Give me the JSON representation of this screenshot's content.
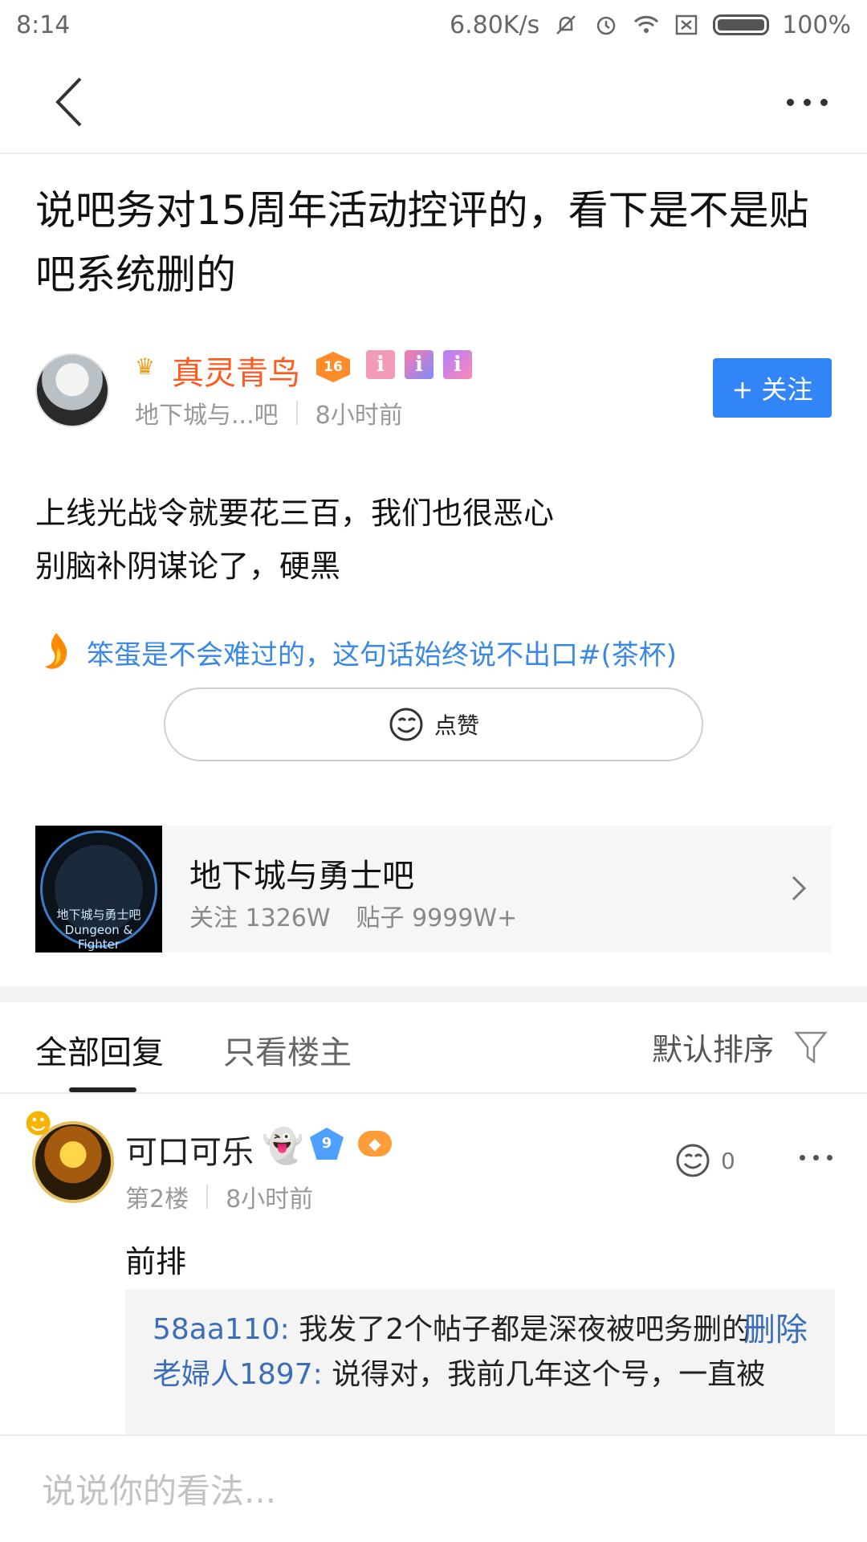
{
  "status_bar": {
    "time": "8:14",
    "network_speed": "6.80K/s",
    "battery": "100%",
    "icons": [
      "bell-mute-icon",
      "alarm-icon",
      "wifi-icon",
      "sim-x-icon",
      "battery-icon"
    ]
  },
  "post": {
    "title": "说吧务对15周年活动控评的，看下是不是贴吧系统删的",
    "author": {
      "name": "真灵青鸟",
      "level": "16",
      "info_badge": "i",
      "forum": "地下城与...吧",
      "time": "8小时前"
    },
    "follow_label": "+ 关注",
    "body_lines": [
      "上线光战令就要花三百，我们也很恶心",
      "别脑补阴谋论了，硬黑"
    ],
    "signature": "笨蛋是不会难过的，这句话始终说不出口#(茶杯)",
    "like_label": "点赞"
  },
  "forum_card": {
    "name": "地下城与勇士吧",
    "followers": "关注 1326W",
    "posts": "贴子 9999W+",
    "logo_text": "地下城与勇士吧 Dungeon & Fighter"
  },
  "tabs": {
    "all_replies": "全部回复",
    "op_only": "只看楼主",
    "sort": "默认排序"
  },
  "replies": [
    {
      "user": "可口可乐",
      "level": "9",
      "floor": "第2楼",
      "time": "8小时前",
      "likes": "0",
      "text": "前排",
      "sub_replies": [
        {
          "user": "58aa110:",
          "text": "我发了2个帖子都是深夜被吧务删的"
        },
        {
          "user": "老婦人1897:",
          "text": "说得对，我前几年这个号，一直被"
        }
      ],
      "delete_label": "删除"
    }
  ],
  "comment_bar": {
    "placeholder": "说说你的看法..."
  },
  "colors": {
    "accent_blue": "#3285f7",
    "author_orange": "#ff5a1f",
    "link_blue": "#3b6db8"
  }
}
